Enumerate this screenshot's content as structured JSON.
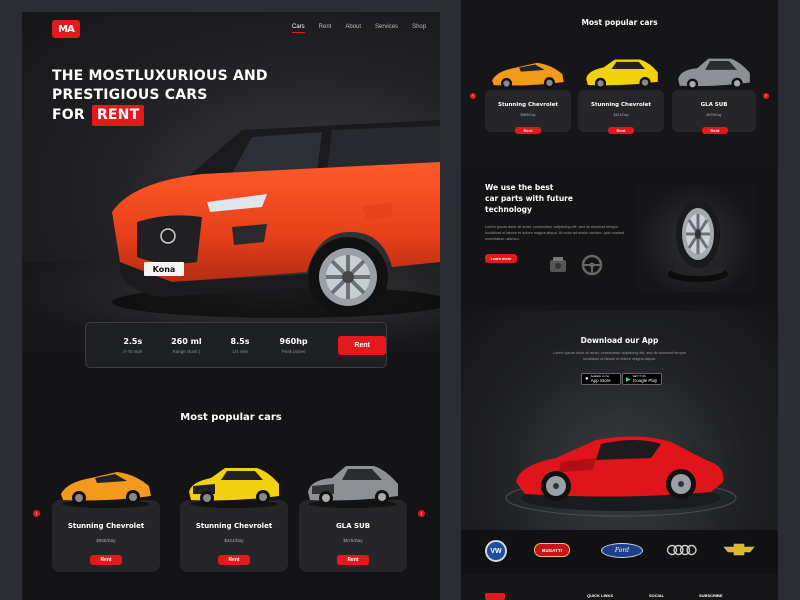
{
  "nav": {
    "logo_text": "MA",
    "items": [
      "Cars",
      "Rent",
      "About",
      "Services",
      "Shop"
    ],
    "active": "Cars"
  },
  "hero": {
    "title_line1": "THE MOSTLUXURIOUS AND",
    "title_line2": "PRESTIGIOUS CARS",
    "title_line3": "FOR",
    "title_highlight": "RENT",
    "plate_text": "Kona"
  },
  "stats": [
    {
      "value": "2.5s",
      "label": "0-70 mph"
    },
    {
      "value": "260 ml",
      "label": "Range (East.)"
    },
    {
      "value": "8.5s",
      "label": "1/4 mile"
    },
    {
      "value": "960hp",
      "label": "Peak power"
    }
  ],
  "stats_rent_label": "Rent",
  "popular": {
    "title": "Most popular cars",
    "cars": [
      {
        "name": "Stunning Chevrolet",
        "price": "$965/Day",
        "rent": "Rent",
        "color": "#f39a1c"
      },
      {
        "name": "Stunning Chevrolet",
        "price": "$421/Day",
        "rent": "Rent",
        "color": "#f2d10f"
      },
      {
        "name": "GLA SUB",
        "price": "$575/Day",
        "rent": "Rent",
        "color": "#8d9196"
      }
    ]
  },
  "tech": {
    "heading_line1": "We use the best",
    "heading_line2": "car parts with future",
    "heading_line3": "technology",
    "body": "Lorem ipsum dolor sit amet, consectetur adipiscing elit, sed do eiusmod tempor incididunt ut labore et dolore magna aliqua. Ut enim ad minim veniam, quis nostrud exercitation ullamco.",
    "button": "Learn more"
  },
  "app": {
    "title": "Download our App",
    "body": "Lorem ipsum dolor sit amet, consectetur adipiscing elit, sed do eiusmod tempor incididunt ut labore et dolore magna aliqua.",
    "appstore_small": "Available on the",
    "appstore": "App Store",
    "googleplay_small": "GET IT ON",
    "googleplay": "Google Play"
  },
  "brands": [
    "VW",
    "BUGATTI",
    "Ford",
    "Audi",
    "Chevrolet"
  ],
  "footer": {
    "quick_links": "QUICK LINKS",
    "social": "SOCIAL",
    "subscribe": "SUBSCRIBE"
  },
  "colors": {
    "accent": "#e3191e",
    "bg": "#141416",
    "page": "#2a2d33"
  }
}
